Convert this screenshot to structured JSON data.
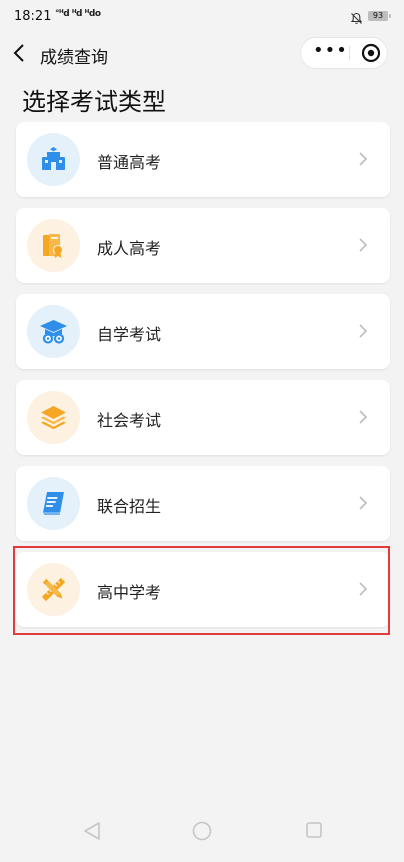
{
  "status_bar": {
    "time": "18:21",
    "signal_text": "°ᴴd ᴴd ᴴdo",
    "battery": "93"
  },
  "navbar": {
    "title": "成绩查询",
    "more_glyph": "•••"
  },
  "page": {
    "heading": "选择考试类型"
  },
  "exam_types": [
    {
      "label": "普通高考",
      "icon": "school-building-icon",
      "color": "#2e8ee8"
    },
    {
      "label": "成人高考",
      "icon": "books-certificate-icon",
      "color": "#f5a623"
    },
    {
      "label": "自学考试",
      "icon": "graduation-cap-icon",
      "color": "#2e8ee8"
    },
    {
      "label": "社会考试",
      "icon": "layers-stack-icon",
      "color": "#f5a623"
    },
    {
      "label": "联合招生",
      "icon": "document-scroll-icon",
      "color": "#2e8ee8"
    },
    {
      "label": "高中学考",
      "icon": "pencil-ruler-icon",
      "color": "#f5a623"
    }
  ],
  "highlighted_item": "高中学考",
  "colors": {
    "blue_accent": "#2e8ee8",
    "orange_accent": "#f5a623",
    "highlight_border": "#e23b3b",
    "background": "#f3f3f3"
  }
}
